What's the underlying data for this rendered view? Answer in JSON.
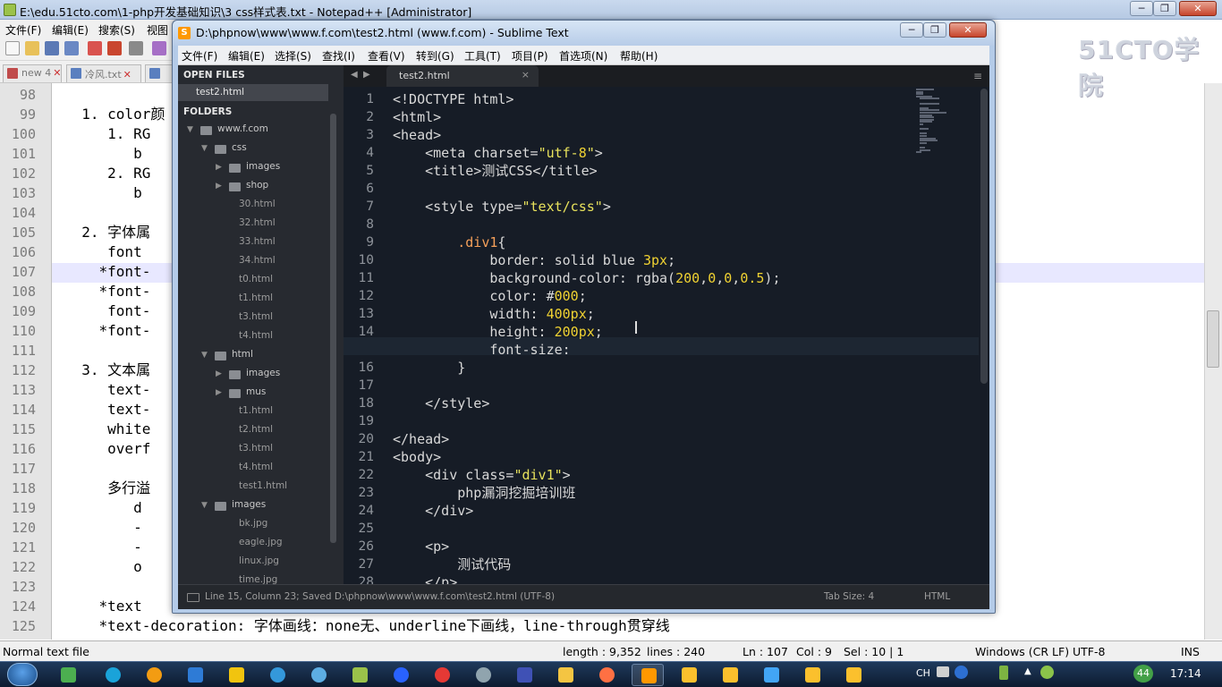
{
  "npp": {
    "title": "E:\\edu.51cto.com\\1-php开发基础知识\\3 css样式表.txt - Notepad++ [Administrator]",
    "menu": [
      "文件(F)",
      "编辑(E)",
      "搜索(S)",
      "视图"
    ],
    "tabs": [
      {
        "label": "new 4",
        "close": "✕"
      },
      {
        "label": "冷风.txt",
        "close": "✕"
      }
    ],
    "lines": [
      {
        "n": "98",
        "t": ""
      },
      {
        "n": "99",
        "t": "  1. color颜"
      },
      {
        "n": "100",
        "t": "     1. RG"
      },
      {
        "n": "101",
        "t": "        b"
      },
      {
        "n": "102",
        "t": "     2. RG"
      },
      {
        "n": "103",
        "t": "        b"
      },
      {
        "n": "104",
        "t": ""
      },
      {
        "n": "105",
        "t": "  2. 字体属"
      },
      {
        "n": "106",
        "t": "     font"
      },
      {
        "n": "107",
        "t": "    *font-"
      },
      {
        "n": "108",
        "t": "    *font-"
      },
      {
        "n": "109",
        "t": "     font-"
      },
      {
        "n": "110",
        "t": "    *font-"
      },
      {
        "n": "111",
        "t": ""
      },
      {
        "n": "112",
        "t": "  3. 文本属"
      },
      {
        "n": "113",
        "t": "     text-"
      },
      {
        "n": "114",
        "t": "     text-"
      },
      {
        "n": "115",
        "t": "     white"
      },
      {
        "n": "116",
        "t": "     overf"
      },
      {
        "n": "117",
        "t": ""
      },
      {
        "n": "118",
        "t": "     多行溢"
      },
      {
        "n": "119",
        "t": "        d"
      },
      {
        "n": "120",
        "t": "        -"
      },
      {
        "n": "121",
        "t": "        -"
      },
      {
        "n": "122",
        "t": "        o"
      },
      {
        "n": "123",
        "t": ""
      },
      {
        "n": "124",
        "t": "    *text"
      },
      {
        "n": "125",
        "t": "    *text-decoration: 字体画线：none无、underline下画线，line-through贯穿线"
      }
    ],
    "status": {
      "type": "Normal text file",
      "length": "length : 9,352",
      "lines": "lines : 240",
      "ln": "Ln : 107",
      "col": "Col : 9",
      "sel": "Sel : 10 | 1",
      "eol": "Windows (CR LF)",
      "enc": "UTF-8",
      "ins": "INS"
    }
  },
  "watermark": "51CTO学院",
  "sublime": {
    "title": "D:\\phpnow\\www\\www.f.com\\test2.html (www.f.com) - Sublime Text",
    "menu": [
      "文件(F)",
      "编辑(E)",
      "选择(S)",
      "查找(I)",
      "查看(V)",
      "转到(G)",
      "工具(T)",
      "项目(P)",
      "首选项(N)",
      "帮助(H)"
    ],
    "sidebar": {
      "open_files_header": "OPEN FILES",
      "open_file": "test2.html",
      "folders_header": "FOLDERS",
      "tree": [
        {
          "label": "www.f.com",
          "kind": "folder-open"
        },
        {
          "label": "css",
          "kind": "folder-open"
        },
        {
          "label": "images",
          "kind": "folder"
        },
        {
          "label": "shop",
          "kind": "folder"
        },
        {
          "label": "30.html",
          "kind": "file"
        },
        {
          "label": "32.html",
          "kind": "file"
        },
        {
          "label": "33.html",
          "kind": "file"
        },
        {
          "label": "34.html",
          "kind": "file"
        },
        {
          "label": "t0.html",
          "kind": "file"
        },
        {
          "label": "t1.html",
          "kind": "file"
        },
        {
          "label": "t3.html",
          "kind": "file"
        },
        {
          "label": "t4.html",
          "kind": "file"
        },
        {
          "label": "html",
          "kind": "folder-open"
        },
        {
          "label": "images",
          "kind": "folder"
        },
        {
          "label": "mus",
          "kind": "folder"
        },
        {
          "label": "t1.html",
          "kind": "file"
        },
        {
          "label": "t2.html",
          "kind": "file"
        },
        {
          "label": "t3.html",
          "kind": "file"
        },
        {
          "label": "t4.html",
          "kind": "file"
        },
        {
          "label": "test1.html",
          "kind": "file"
        },
        {
          "label": "images",
          "kind": "folder-open"
        },
        {
          "label": "bk.jpg",
          "kind": "file"
        },
        {
          "label": "eagle.jpg",
          "kind": "file"
        },
        {
          "label": "linux.jpg",
          "kind": "file"
        },
        {
          "label": "time.jpg",
          "kind": "file"
        }
      ]
    },
    "tab": {
      "label": "test2.html",
      "close": "×"
    },
    "code_lines": [
      {
        "n": "1",
        "t": "<!DOCTYPE html>"
      },
      {
        "n": "2",
        "t": "<html>"
      },
      {
        "n": "3",
        "t": "<head>"
      },
      {
        "n": "4",
        "t": "    <meta charset=\"utf-8\">"
      },
      {
        "n": "5",
        "t": "    <title>测试CSS</title>"
      },
      {
        "n": "6",
        "t": ""
      },
      {
        "n": "7",
        "t": "    <style type=\"text/css\">"
      },
      {
        "n": "8",
        "t": ""
      },
      {
        "n": "9",
        "t": "        .div1{"
      },
      {
        "n": "10",
        "t": "            border: solid blue 3px;"
      },
      {
        "n": "11",
        "t": "            background-color: rgba(200,0,0,0.5);"
      },
      {
        "n": "12",
        "t": "            color: #000;"
      },
      {
        "n": "13",
        "t": "            width: 400px;"
      },
      {
        "n": "14",
        "t": "            height: 200px;"
      },
      {
        "n": "15",
        "t": "            font-size:"
      },
      {
        "n": "16",
        "t": "        }"
      },
      {
        "n": "17",
        "t": ""
      },
      {
        "n": "18",
        "t": "    </style>"
      },
      {
        "n": "19",
        "t": ""
      },
      {
        "n": "20",
        "t": "</head>"
      },
      {
        "n": "21",
        "t": "<body>"
      },
      {
        "n": "22",
        "t": "    <div class=\"div1\">"
      },
      {
        "n": "23",
        "t": "        php漏洞挖掘培训班"
      },
      {
        "n": "24",
        "t": "    </div>"
      },
      {
        "n": "25",
        "t": ""
      },
      {
        "n": "26",
        "t": "    <p>"
      },
      {
        "n": "27",
        "t": "        测试代码"
      },
      {
        "n": "28",
        "t": "    </p>"
      }
    ],
    "status": {
      "position": "Line 15, Column 23; Saved D:\\phpnow\\www\\www.f.com\\test2.html (UTF-8)",
      "tab_size": "Tab Size: 4",
      "syntax": "HTML"
    }
  },
  "taskbar": {
    "lang": "CH",
    "badge": "44",
    "clock": "17:14"
  }
}
